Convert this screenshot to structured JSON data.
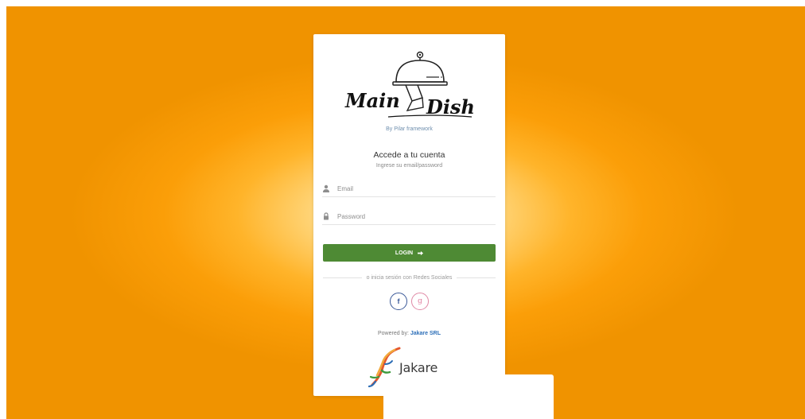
{
  "brand": {
    "logo_left": "Main",
    "logo_right": "Dish",
    "by_line": "By Pilar framework"
  },
  "login": {
    "title": "Accede a tu cuenta",
    "subtitle": "Ingrese su email/password",
    "email_placeholder": "Email",
    "password_placeholder": "Password",
    "button_label": "LOGIN",
    "social_divider": "o inicia sesión con Redes Sociales",
    "facebook_glyph": "f",
    "google_glyph": "g"
  },
  "footer": {
    "powered_label": "Powered by:",
    "powered_company": "Jakare SRL",
    "company_logo_text": "Jakare"
  },
  "colors": {
    "background": "#fb9e08",
    "login_button": "#4e8a34",
    "facebook": "#3b5998",
    "google": "#e08aa6",
    "link": "#2d6fb8"
  },
  "icons": {
    "email": "user-icon",
    "password": "lock-icon",
    "login_arrow": "arrow-right-icon"
  }
}
